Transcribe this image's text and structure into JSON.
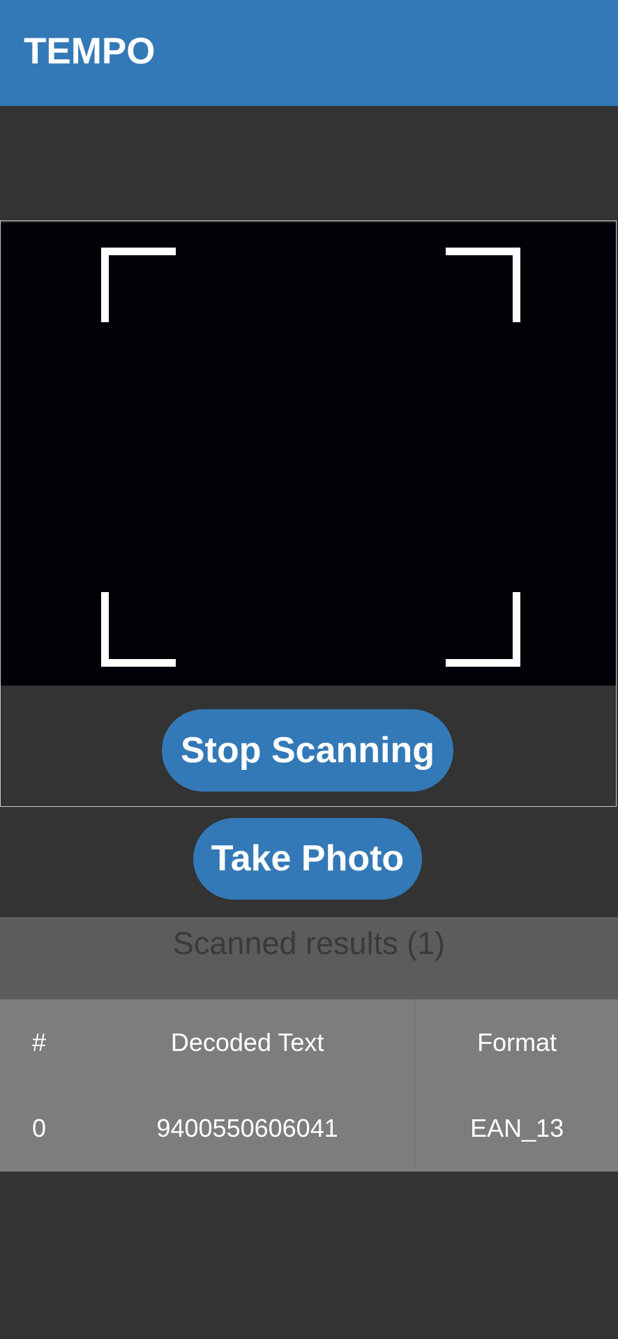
{
  "app": {
    "title": "TEMPO"
  },
  "scanner": {
    "stop_label": "Stop Scanning",
    "take_photo_label": "Take Photo"
  },
  "results": {
    "title": "Scanned results (1)",
    "columns": [
      "#",
      "Decoded Text",
      "Format"
    ],
    "rows": [
      {
        "index": "0",
        "decoded_text": "9400550606041",
        "format": "EAN_13"
      }
    ]
  },
  "colors": {
    "accent": "#3479b7",
    "background": "#333333",
    "camera": "#020108",
    "table_bg": "#7d7d7d",
    "results_header_bg": "#5c5c5c"
  },
  "icons": {
    "scan_frame": "scan-frame-corners"
  }
}
